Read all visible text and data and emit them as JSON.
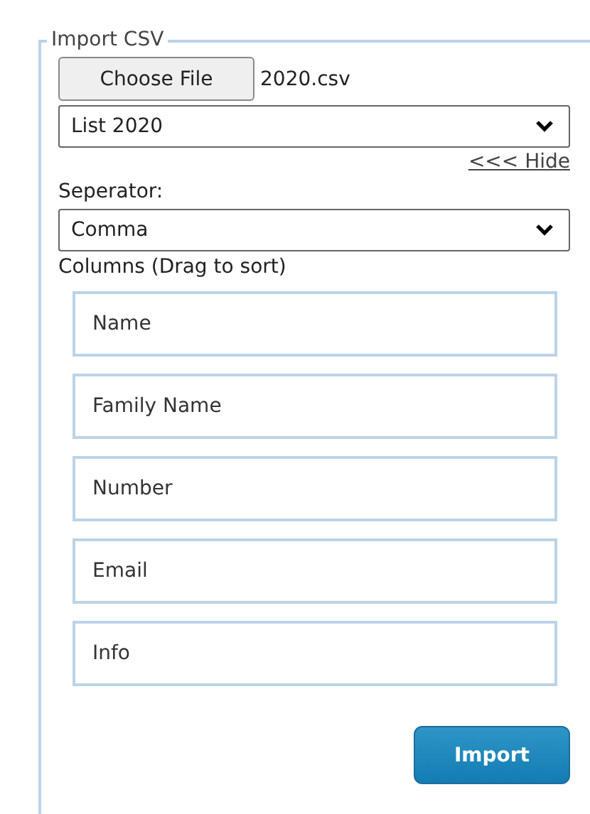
{
  "panel": {
    "legend": "Import CSV"
  },
  "file": {
    "button": "Choose File",
    "filename": "2020.csv"
  },
  "list_select": {
    "value": "List 2020"
  },
  "hide_link": "<<< Hide",
  "separator": {
    "label": "Seperator:",
    "value": "Comma"
  },
  "columns": {
    "label": "Columns (Drag to sort)",
    "items": [
      "Name",
      "Family Name",
      "Number",
      "Email",
      "Info"
    ]
  },
  "import_button": "Import"
}
